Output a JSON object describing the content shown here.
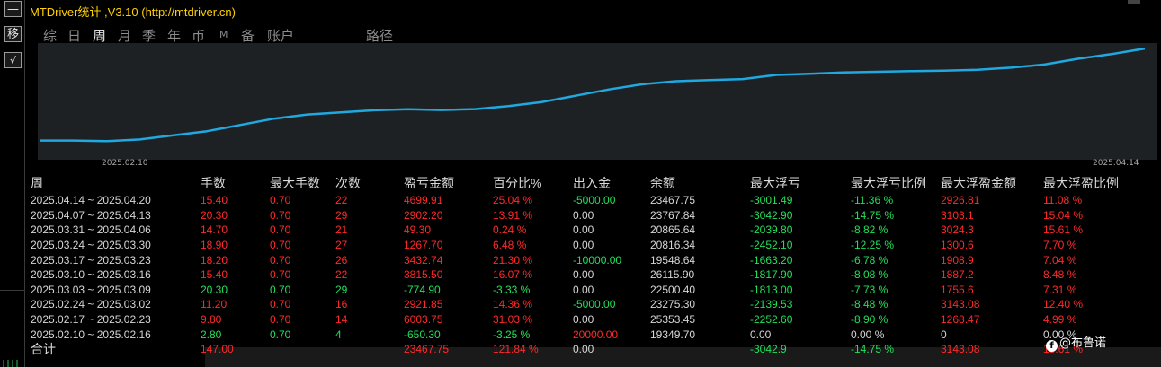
{
  "window": {
    "title": "MTDriver统计 ,V3.10 (http://mtdriver.cn)"
  },
  "toolbar": {
    "minimize": "—",
    "move": "移",
    "check": "√"
  },
  "tabs": [
    "综",
    "日",
    "周",
    "月",
    "季",
    "年",
    "币",
    "M",
    "备",
    "账户",
    "路径"
  ],
  "active_tab": "周",
  "chart_data": {
    "type": "line",
    "x_start_label": "2025.02.10",
    "x_end_label": "2025.04.14",
    "line_color": "#1fa9e0",
    "background": "#1e2124",
    "ylim": [
      18600,
      23900
    ],
    "points": [
      19350,
      19349.7,
      19320,
      19400,
      19600,
      19800,
      20100,
      20400,
      20600,
      20700,
      20800,
      20850,
      20816.34,
      20860,
      21000,
      21200,
      21500,
      21800,
      22050,
      22200,
      22250,
      22300,
      22500.4,
      22550,
      22620,
      22650,
      22680,
      22700,
      22750,
      22850,
      23000,
      23275.3,
      23500,
      23767.84
    ]
  },
  "table": {
    "headers": [
      "周",
      "手数",
      "最大手数",
      "次数",
      "盈亏金额",
      "百分比%",
      "出入金",
      "余额",
      "最大浮亏",
      "最大浮亏比例",
      "最大浮盈金额",
      "最大浮盈比例"
    ],
    "rows": [
      [
        "2025.04.14 ~ 2025.04.20",
        "15.40",
        "0.70",
        "22",
        "4699.91",
        "25.04 %",
        "-5000.00",
        "23467.75",
        "-3001.49",
        "-11.36 %",
        "2926.81",
        "11.08 %"
      ],
      [
        "2025.04.07 ~ 2025.04.13",
        "20.30",
        "0.70",
        "29",
        "2902.20",
        "13.91 %",
        "0.00",
        "23767.84",
        "-3042.90",
        "-14.75 %",
        "3103.1",
        "15.04 %"
      ],
      [
        "2025.03.31 ~ 2025.04.06",
        "14.70",
        "0.70",
        "21",
        "49.30",
        "0.24 %",
        "0.00",
        "20865.64",
        "-2039.80",
        "-8.82 %",
        "3024.3",
        "15.61 %"
      ],
      [
        "2025.03.24 ~ 2025.03.30",
        "18.90",
        "0.70",
        "27",
        "1267.70",
        "6.48 %",
        "0.00",
        "20816.34",
        "-2452.10",
        "-12.25 %",
        "1300.6",
        "7.70 %"
      ],
      [
        "2025.03.17 ~ 2025.03.23",
        "18.20",
        "0.70",
        "26",
        "3432.74",
        "21.30 %",
        "-10000.00",
        "19548.64",
        "-1663.20",
        "-6.78 %",
        "1908.9",
        "7.04 %"
      ],
      [
        "2025.03.10 ~ 2025.03.16",
        "15.40",
        "0.70",
        "22",
        "3815.50",
        "16.07 %",
        "0.00",
        "26115.90",
        "-1817.90",
        "-8.08 %",
        "1887.2",
        "8.48 %"
      ],
      [
        "2025.03.03 ~ 2025.03.09",
        "20.30",
        "0.70",
        "29",
        "-774.90",
        "-3.33 %",
        "0.00",
        "22500.40",
        "-1813.00",
        "-7.73 %",
        "1755.6",
        "7.31 %"
      ],
      [
        "2025.02.24 ~ 2025.03.02",
        "11.20",
        "0.70",
        "16",
        "2921.85",
        "14.36 %",
        "-5000.00",
        "23275.30",
        "-2139.53",
        "-8.48 %",
        "3143.08",
        "12.40 %"
      ],
      [
        "2025.02.17 ~ 2025.02.23",
        "9.80",
        "0.70",
        "14",
        "6003.75",
        "31.03 %",
        "0.00",
        "25353.45",
        "-2252.60",
        "-8.90 %",
        "1268.47",
        "4.99 %"
      ],
      [
        "2025.02.10 ~ 2025.02.16",
        "2.80",
        "0.70",
        "4",
        "-650.30",
        "-3.25 %",
        "20000.00",
        "19349.70",
        "0.00",
        "0.00 %",
        "0",
        "0.00 %"
      ]
    ],
    "row_colors": [
      "red",
      "red",
      "red",
      "red",
      "red",
      "red",
      "green",
      "red",
      "red",
      "green"
    ],
    "total": [
      "合计",
      "147.00",
      "",
      "",
      "23467.75",
      "121.84 %",
      "0.00",
      "",
      "-3042.9",
      "-14.75 %",
      "3143.08",
      "15.61 %"
    ]
  },
  "watermark": {
    "icon": "f",
    "text": "@布鲁诺"
  },
  "colors": {
    "title": "#ffd200",
    "positive": "#ff2a2a",
    "negative": "#21e05a",
    "neutral": "#d6d6d6",
    "line": "#1fa9e0"
  }
}
